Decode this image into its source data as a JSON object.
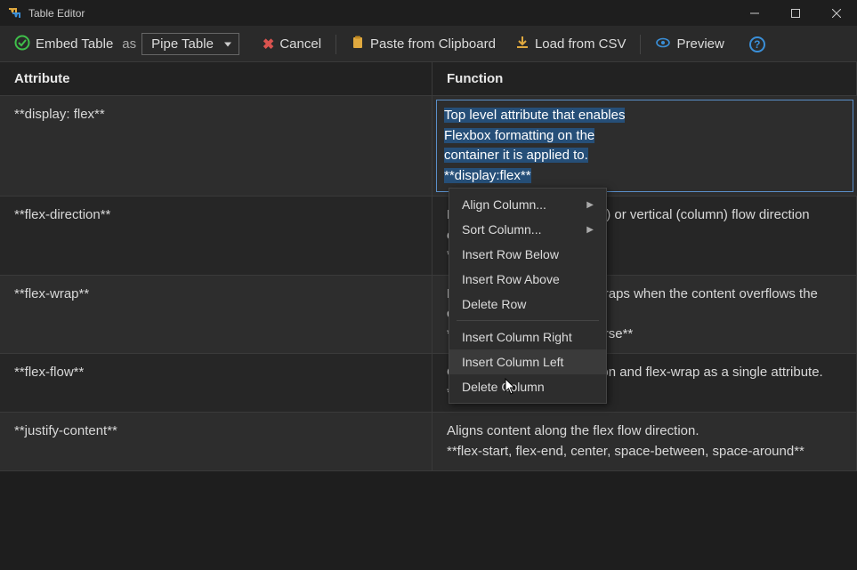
{
  "window": {
    "title": "Table Editor"
  },
  "toolbar": {
    "embed_label": "Embed Table",
    "as_label": "as",
    "table_type": "Pipe Table",
    "cancel_label": "Cancel",
    "paste_label": "Paste from Clipboard",
    "load_csv_label": "Load from CSV",
    "preview_label": "Preview"
  },
  "columns": [
    "Attribute",
    "Function"
  ],
  "rows": [
    {
      "attr": "**display: flex**",
      "func": "Top level attribute that enables Flexbox formatting on the container it is applied to.\n**display:flex**",
      "editing": true
    },
    {
      "attr": "**flex-direction**",
      "func": "Determines horizontal (row) or vertical (column) flow direction elements in the container.\n**row, column**"
    },
    {
      "attr": "**flex-wrap**",
      "func": "Determines how content wraps when the content overflows the container.\n**wrap, nowrap, wrap-reverse**"
    },
    {
      "attr": "**flex-flow**",
      "func": "Combination of flex-direction and flex-wrap as a single attribute.\n**flex-flow: row nowrap**"
    },
    {
      "attr": "**justify-content**",
      "func": "Aligns content along the flex flow direction.\n**flex-start, flex-end, center, space-between, space-around**"
    }
  ],
  "context_menu": {
    "items": [
      {
        "label": "Align Column...",
        "submenu": true
      },
      {
        "label": "Sort Column...",
        "submenu": true
      },
      {
        "label": "Insert Row Below"
      },
      {
        "label": "Insert Row Above"
      },
      {
        "label": "Delete Row"
      },
      {
        "sep": true
      },
      {
        "label": "Insert Column Right"
      },
      {
        "label": "Insert Column Left",
        "highlighted": true
      },
      {
        "label": "Delete Column"
      }
    ]
  }
}
